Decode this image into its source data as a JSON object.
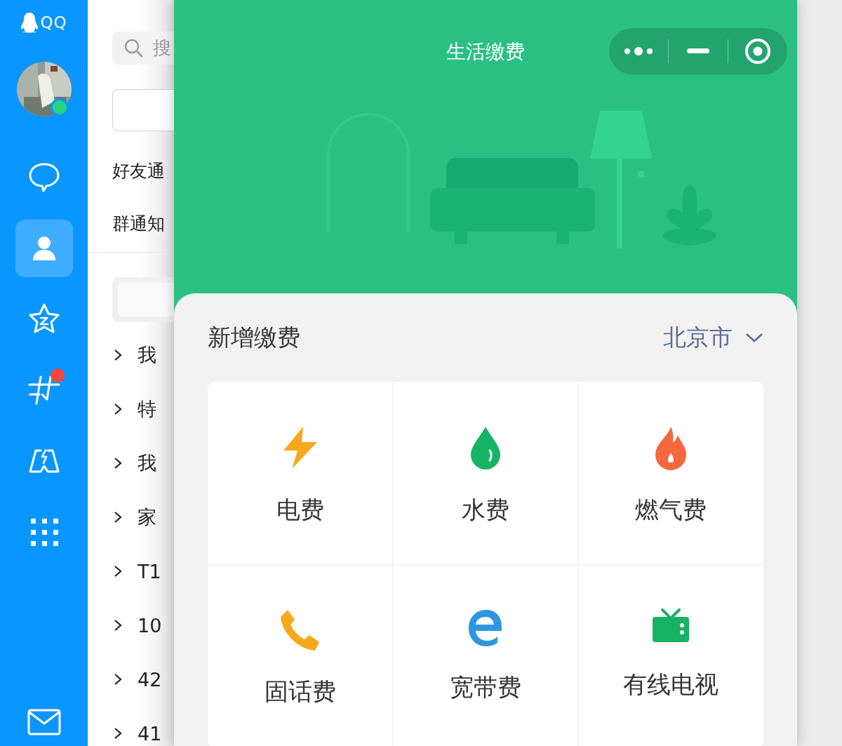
{
  "sidebar": {
    "logo": "QQ",
    "avatar": {
      "kind": "picture",
      "online": true
    },
    "nav": [
      {
        "kind": "chat",
        "selected": false,
        "badge": false
      },
      {
        "kind": "contacts",
        "selected": true,
        "badge": false
      },
      {
        "kind": "star",
        "selected": false,
        "badge": false
      },
      {
        "kind": "hash",
        "selected": false,
        "badge": true
      },
      {
        "kind": "game",
        "selected": false,
        "badge": false
      },
      {
        "kind": "apps",
        "selected": false,
        "badge": false
      }
    ],
    "bottom": [
      {
        "kind": "mail"
      }
    ]
  },
  "contacts": {
    "search": {
      "placeholder": "搜"
    },
    "notices": [
      "好友通",
      "群通知"
    ],
    "groups": [
      {
        "label": "我",
        "expanded": false
      },
      {
        "label": "特",
        "expanded": false
      },
      {
        "label": "我",
        "expanded": false
      },
      {
        "label": "家",
        "expanded": false
      },
      {
        "label": "T1",
        "expanded": false
      },
      {
        "label": "10",
        "expanded": false
      },
      {
        "label": "42",
        "expanded": false
      },
      {
        "label": "41",
        "expanded": false
      }
    ]
  },
  "miniapp": {
    "title": "生活缴费",
    "section_title": "新增缴费",
    "city": "北京市",
    "services": [
      {
        "label": "电费",
        "kind": "electricity"
      },
      {
        "label": "水费",
        "kind": "water"
      },
      {
        "label": "燃气费",
        "kind": "gas"
      },
      {
        "label": "固话费",
        "kind": "phone"
      },
      {
        "label": "宽带费",
        "kind": "broadband"
      },
      {
        "label": "有线电视",
        "kind": "tv"
      }
    ]
  }
}
